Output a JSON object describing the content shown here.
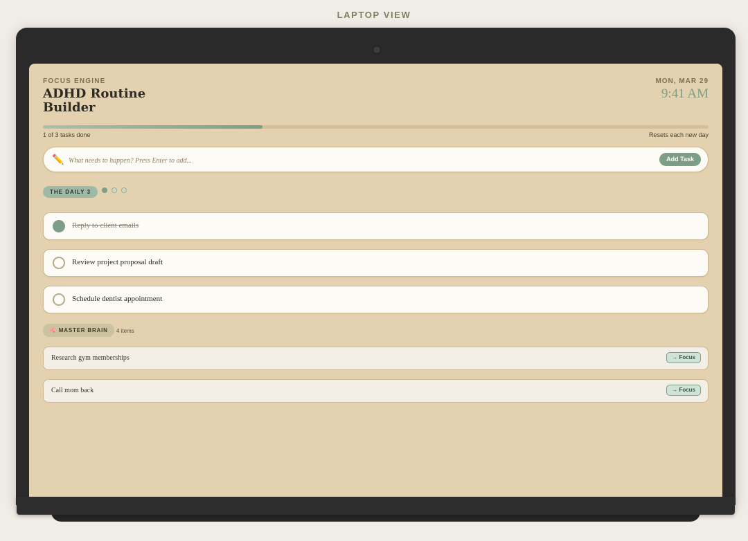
{
  "view_label": "LAPTOP VIEW",
  "app": {
    "eyebrow": "FOCUS ENGINE",
    "title": "ADHD Routine Builder",
    "date": "MON, MAR 29",
    "time": "9:41 AM"
  },
  "progress": {
    "completed": 1,
    "total": 3,
    "fraction": 0.33,
    "count_text": "1 of 3 tasks done",
    "note": "Resets each new day"
  },
  "input": {
    "icon": "pencil-icon",
    "placeholder": "What needs to happen? Press Enter to add...",
    "value": "",
    "button_label": "Add Task"
  },
  "daily": {
    "badge": "THE DAILY 3",
    "tasks": [
      {
        "label": "Reply to client emails",
        "done": true
      },
      {
        "label": "Review project proposal draft",
        "done": false
      },
      {
        "label": "Schedule dentist appointment",
        "done": false
      }
    ]
  },
  "master_brain": {
    "badge": "🧠 MASTER BRAIN",
    "count": "4 items",
    "items": [
      {
        "label": "Research gym memberships",
        "action": "→ Focus"
      },
      {
        "label": "Call mom back",
        "action": "→ Focus"
      }
    ]
  },
  "colors": {
    "accent": "#7d9e86",
    "screen_bg": "#e3d1b0",
    "card_bg": "#fdfbf6"
  }
}
